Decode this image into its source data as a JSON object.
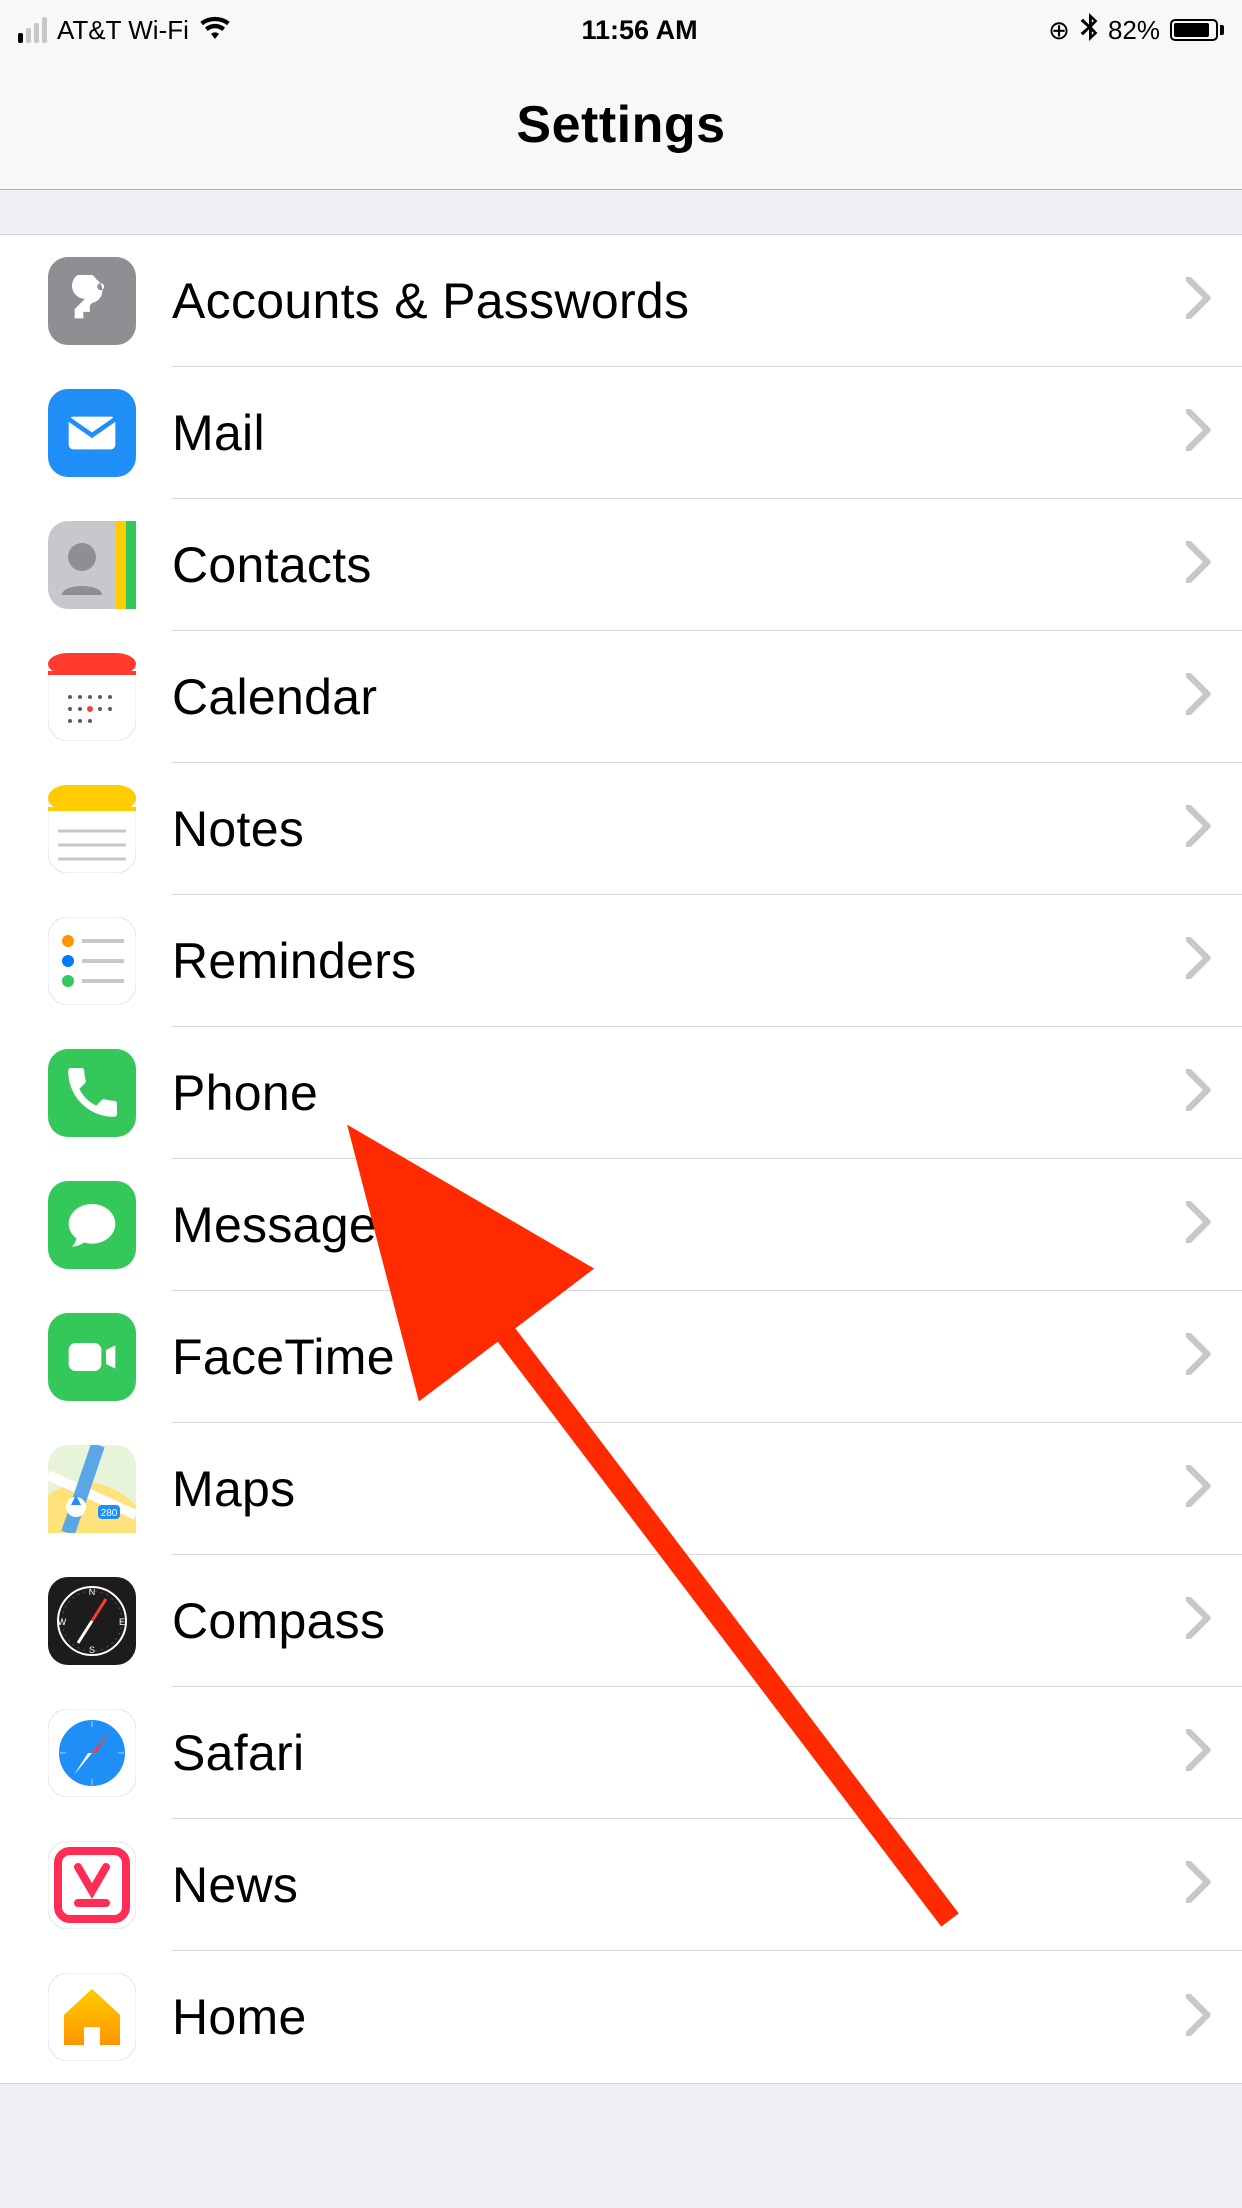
{
  "status": {
    "carrier": "AT&T Wi-Fi",
    "time": "11:56 AM",
    "battery_pct": "82%"
  },
  "nav": {
    "title": "Settings"
  },
  "rows": [
    {
      "id": "accounts-passwords",
      "label": "Accounts & Passwords",
      "icon": "key",
      "bg": "#8e8e93"
    },
    {
      "id": "mail",
      "label": "Mail",
      "icon": "mail",
      "bg": "#1f8ef7"
    },
    {
      "id": "contacts",
      "label": "Contacts",
      "icon": "contacts",
      "bg": "#bcbcc0"
    },
    {
      "id": "calendar",
      "label": "Calendar",
      "icon": "calendar",
      "bg": "#ffffff"
    },
    {
      "id": "notes",
      "label": "Notes",
      "icon": "notes",
      "bg": "#ffffff"
    },
    {
      "id": "reminders",
      "label": "Reminders",
      "icon": "reminders",
      "bg": "#ffffff"
    },
    {
      "id": "phone",
      "label": "Phone",
      "icon": "phone",
      "bg": "#34c759"
    },
    {
      "id": "messages",
      "label": "Messages",
      "icon": "messages",
      "bg": "#34c759"
    },
    {
      "id": "facetime",
      "label": "FaceTime",
      "icon": "facetime",
      "bg": "#34c759"
    },
    {
      "id": "maps",
      "label": "Maps",
      "icon": "maps",
      "bg": "#ffffff"
    },
    {
      "id": "compass",
      "label": "Compass",
      "icon": "compass",
      "bg": "#1c1c1e"
    },
    {
      "id": "safari",
      "label": "Safari",
      "icon": "safari",
      "bg": "#ffffff"
    },
    {
      "id": "news",
      "label": "News",
      "icon": "news",
      "bg": "#ffffff"
    },
    {
      "id": "home",
      "label": "Home",
      "icon": "home",
      "bg": "#ffffff"
    }
  ],
  "annotation": {
    "arrow_target": "messages"
  }
}
